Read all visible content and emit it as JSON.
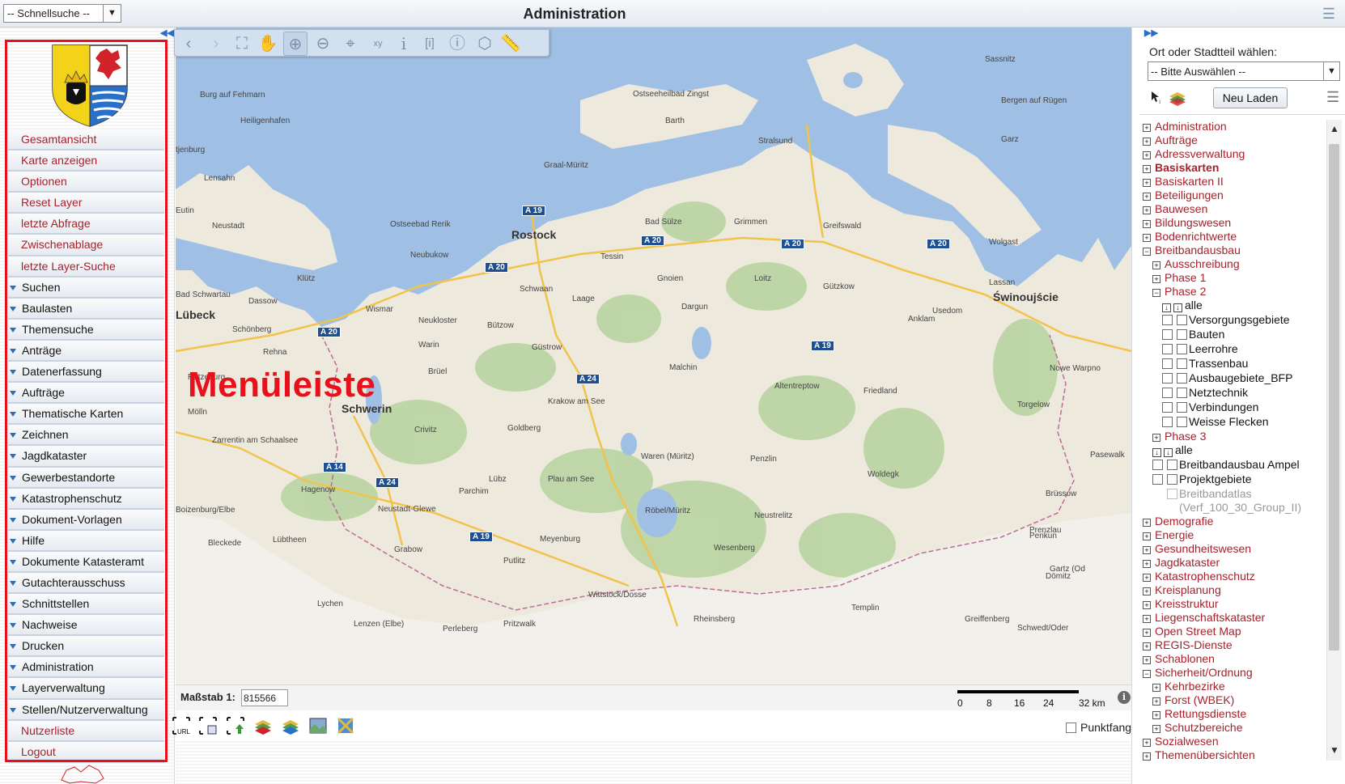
{
  "top": {
    "quick_search": "-- Schnellsuche --",
    "title": "Administration"
  },
  "menu": {
    "items": [
      {
        "label": "Gesamtansicht",
        "type": "link"
      },
      {
        "label": "Karte anzeigen",
        "type": "link"
      },
      {
        "label": "Optionen",
        "type": "link"
      },
      {
        "label": "Reset Layer",
        "type": "link"
      },
      {
        "label": "letzte Abfrage",
        "type": "link"
      },
      {
        "label": "Zwischenablage",
        "type": "link"
      },
      {
        "label": "letzte Layer-Suche",
        "type": "link"
      },
      {
        "label": "Suchen",
        "type": "group"
      },
      {
        "label": "Baulasten",
        "type": "group"
      },
      {
        "label": "Themensuche",
        "type": "group"
      },
      {
        "label": "Anträge",
        "type": "group"
      },
      {
        "label": "Datenerfassung",
        "type": "group"
      },
      {
        "label": "Aufträge",
        "type": "group"
      },
      {
        "label": "Thematische Karten",
        "type": "group"
      },
      {
        "label": "Zeichnen",
        "type": "group"
      },
      {
        "label": "Jagdkataster",
        "type": "group"
      },
      {
        "label": "Gewerbestandorte",
        "type": "group"
      },
      {
        "label": "Katastrophenschutz",
        "type": "group"
      },
      {
        "label": "Dokument-Vorlagen",
        "type": "group"
      },
      {
        "label": "Hilfe",
        "type": "group"
      },
      {
        "label": "Dokumente Katasteramt",
        "type": "group"
      },
      {
        "label": "Gutachterausschuss",
        "type": "group"
      },
      {
        "label": "Schnittstellen",
        "type": "group"
      },
      {
        "label": "Nachweise",
        "type": "group"
      },
      {
        "label": "Drucken",
        "type": "group"
      },
      {
        "label": "Administration",
        "type": "group"
      },
      {
        "label": "Layerverwaltung",
        "type": "group"
      },
      {
        "label": "Stellen/Nutzerverwaltung",
        "type": "group"
      },
      {
        "label": "Nutzerliste",
        "type": "link"
      },
      {
        "label": "Logout",
        "type": "link"
      }
    ]
  },
  "annotation": "Menüleiste",
  "map": {
    "places": [
      "Sassnitz",
      "Burg auf Fehmarn",
      "Ostseeheilbad Zingst",
      "Bergen auf Rügen",
      "Barth",
      "Heiligenhafen",
      "Garz",
      "Stralsund",
      "tjenburg",
      "Graal-Müritz",
      "Lensahn",
      "Eutin",
      "Neustadt",
      "Ostseebad Rerik",
      "Rostock",
      "Bad Sülze",
      "Grimmen",
      "Greifswald",
      "Wolgast",
      "Neubukow",
      "Tessin",
      "Klütz",
      "Schwaan",
      "Gnoien",
      "Loitz",
      "Gützkow",
      "Lassan",
      "Świnoujście",
      "Bad Schwartau",
      "Dassow",
      "Laage",
      "Dargun",
      "Usedom",
      "Lübeck",
      "Wismar",
      "Neukloster",
      "Bützow",
      "Anklam",
      "Schönberg",
      "Rehna",
      "Warin",
      "Güstrow",
      "Malchin",
      "Nowe Warpno",
      "Ratzeburg",
      "Brüel",
      "Altentreptow",
      "Mölln",
      "Schwerin",
      "Krakow am See",
      "Friedland",
      "Torgelow",
      "Crivitz",
      "Goldberg",
      "Zarrentin am Schaalsee",
      "Waren (Müritz)",
      "Penzlin",
      "Pasewalk",
      "Lübz",
      "Plau am See",
      "Woldegk",
      "Hagenow",
      "Parchim",
      "Brüssow",
      "Boizenburg/Elbe",
      "Neustadt-Glewe",
      "Röbel/Müritz",
      "Neustrelitz",
      "Lübtheen",
      "Prenzlau",
      "Bleckede",
      "Grabow",
      "Meyenburg",
      "Wesenberg",
      "Penkun",
      "Putlitz",
      "Gartz (Od",
      "Lychen",
      "Dömitz",
      "Wittstock/Dosse",
      "Templin",
      "Pritzwalk",
      "Lenzen (Elbe)",
      "Perleberg",
      "Rheinsberg",
      "Greiffenberg",
      "Schwedt/Oder"
    ],
    "roads": [
      "A 19",
      "A 20",
      "A 20",
      "A 20",
      "A 20",
      "A 20",
      "A 19",
      "A 24",
      "A 14",
      "A 24",
      "A 19"
    ]
  },
  "status": {
    "scale_label": "Maßstab 1:",
    "scale_value": "815566",
    "scale_ticks": [
      "0",
      "8",
      "16",
      "24",
      "32 km"
    ],
    "punktfang": "Punktfang"
  },
  "right": {
    "ort_label": "Ort oder Stadtteil wählen:",
    "ort_select": "-- Bitte Auswählen --",
    "reload": "Neu Laden",
    "tree": [
      {
        "label": "Administration",
        "kind": "g",
        "indent": 0,
        "icon": "plus"
      },
      {
        "label": "Aufträge",
        "kind": "g",
        "indent": 0,
        "icon": "plus"
      },
      {
        "label": "Adressverwaltung",
        "kind": "g",
        "indent": 0,
        "icon": "plus"
      },
      {
        "label": "Basiskarten",
        "kind": "gb",
        "indent": 0,
        "icon": "plus"
      },
      {
        "label": "Basiskarten II",
        "kind": "g",
        "indent": 0,
        "icon": "plus"
      },
      {
        "label": "Beteiligungen",
        "kind": "g",
        "indent": 0,
        "icon": "plus"
      },
      {
        "label": "Bauwesen",
        "kind": "g",
        "indent": 0,
        "icon": "plus"
      },
      {
        "label": "Bildungswesen",
        "kind": "g",
        "indent": 0,
        "icon": "plus"
      },
      {
        "label": "Bodenrichtwerte",
        "kind": "g",
        "indent": 0,
        "icon": "plus"
      },
      {
        "label": "Breitbandausbau",
        "kind": "g",
        "indent": 0,
        "icon": "minus"
      },
      {
        "label": "Ausschreibung",
        "kind": "g",
        "indent": 1,
        "icon": "plus"
      },
      {
        "label": "Phase 1",
        "kind": "g",
        "indent": 1,
        "icon": "plus"
      },
      {
        "label": "Phase 2",
        "kind": "g",
        "indent": 1,
        "icon": "minus"
      },
      {
        "label": "alle",
        "kind": "all",
        "indent": 2
      },
      {
        "label": "Versorgungsgebiete",
        "kind": "layer",
        "indent": 2
      },
      {
        "label": "Bauten",
        "kind": "layer",
        "indent": 2
      },
      {
        "label": "Leerrohre",
        "kind": "layer",
        "indent": 2
      },
      {
        "label": "Trassenbau",
        "kind": "layer",
        "indent": 2
      },
      {
        "label": "Ausbaugebiete_BFP",
        "kind": "layer",
        "indent": 2
      },
      {
        "label": "Netztechnik",
        "kind": "layer",
        "indent": 2
      },
      {
        "label": "Verbindungen",
        "kind": "layer",
        "indent": 2
      },
      {
        "label": "Weisse Flecken",
        "kind": "layer",
        "indent": 2
      },
      {
        "label": "Phase 3",
        "kind": "g",
        "indent": 1,
        "icon": "plus"
      },
      {
        "label": "alle",
        "kind": "all",
        "indent": 1
      },
      {
        "label": "Breitbandausbau Ampel",
        "kind": "layer",
        "indent": 1
      },
      {
        "label": "Projektgebiete",
        "kind": "layer",
        "indent": 1
      },
      {
        "label": "Breitbandatlas",
        "kind": "disabled",
        "indent": 1
      },
      {
        "label": "(Verf_100_30_Group_II)",
        "kind": "disabledcont",
        "indent": 1
      },
      {
        "label": "Demografie",
        "kind": "g",
        "indent": 0,
        "icon": "plus"
      },
      {
        "label": "Energie",
        "kind": "g",
        "indent": 0,
        "icon": "plus"
      },
      {
        "label": "Gesundheitswesen",
        "kind": "g",
        "indent": 0,
        "icon": "plus"
      },
      {
        "label": "Jagdkataster",
        "kind": "g",
        "indent": 0,
        "icon": "plus"
      },
      {
        "label": "Katastrophenschutz",
        "kind": "g",
        "indent": 0,
        "icon": "plus"
      },
      {
        "label": "Kreisplanung",
        "kind": "g",
        "indent": 0,
        "icon": "plus"
      },
      {
        "label": "Kreisstruktur",
        "kind": "g",
        "indent": 0,
        "icon": "plus"
      },
      {
        "label": "Liegenschaftskataster",
        "kind": "g",
        "indent": 0,
        "icon": "plus"
      },
      {
        "label": "Open Street Map",
        "kind": "g",
        "indent": 0,
        "icon": "plus"
      },
      {
        "label": "REGIS-Dienste",
        "kind": "g",
        "indent": 0,
        "icon": "plus"
      },
      {
        "label": "Schablonen",
        "kind": "g",
        "indent": 0,
        "icon": "plus"
      },
      {
        "label": "Sicherheit/Ordnung",
        "kind": "g",
        "indent": 0,
        "icon": "minus"
      },
      {
        "label": "Kehrbezirke",
        "kind": "g",
        "indent": 1,
        "icon": "plus"
      },
      {
        "label": "Forst (WBEK)",
        "kind": "g",
        "indent": 1,
        "icon": "plus"
      },
      {
        "label": "Rettungsdienste",
        "kind": "g",
        "indent": 1,
        "icon": "plus"
      },
      {
        "label": "Schutzbereiche",
        "kind": "g",
        "indent": 1,
        "icon": "plus"
      },
      {
        "label": "Sozialwesen",
        "kind": "g",
        "indent": 0,
        "icon": "plus"
      },
      {
        "label": "Themenübersichten",
        "kind": "g",
        "indent": 0,
        "icon": "plus"
      }
    ]
  },
  "colors": {
    "accent_red": "#a5222b",
    "menu_group_arrow": "#2f6db8",
    "highlight_frame": "#e8101a",
    "sea": "#9fc0e4",
    "land": "#ede9dc",
    "forest": "#b9d5a2"
  }
}
